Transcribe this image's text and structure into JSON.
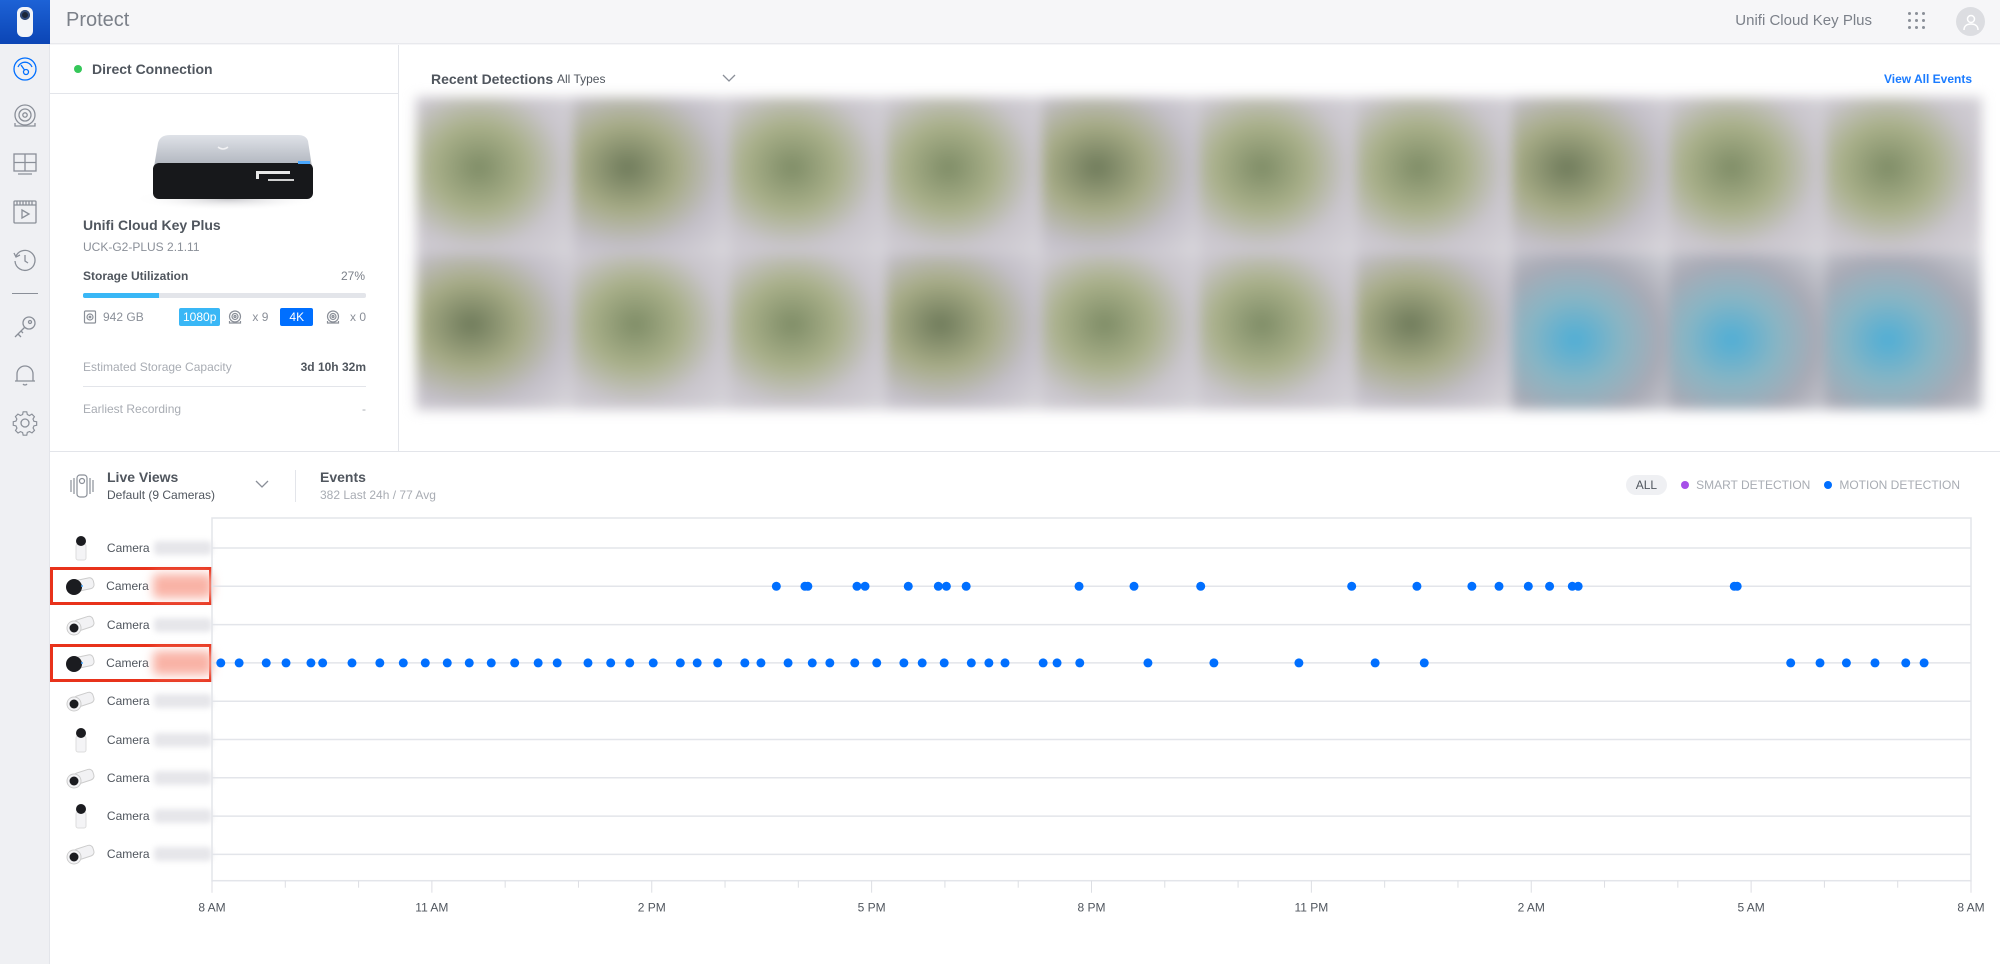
{
  "header": {
    "app_title": "Protect",
    "controller_name": "Unifi Cloud Key Plus",
    "apps_icon": "grid-dots-icon",
    "avatar_icon": "user-icon"
  },
  "sidebar": {
    "logo": "protect-camera-logo",
    "items": [
      {
        "name": "dashboard",
        "icon": "dashboard-icon",
        "active": true
      },
      {
        "name": "devices",
        "icon": "camera-icon",
        "active": false
      },
      {
        "name": "liveview",
        "icon": "grid-icon",
        "active": false
      },
      {
        "name": "timelapse",
        "icon": "video-icon",
        "active": false
      },
      {
        "name": "events",
        "icon": "history-icon",
        "active": false
      },
      {
        "name": "access",
        "icon": "key-icon",
        "active": false
      },
      {
        "name": "notifications",
        "icon": "bell-icon",
        "active": false
      },
      {
        "name": "settings",
        "icon": "gear-icon",
        "active": false
      }
    ]
  },
  "status": {
    "connection_label": "Direct Connection",
    "connection_color": "#35c759"
  },
  "device": {
    "name": "Unifi Cloud Key Plus",
    "model": "UCK-G2-PLUS 2.1.11",
    "storage_label": "Storage Utilization",
    "storage_percent_text": "27%",
    "storage_percent": 27,
    "disk_size": "942 GB",
    "res_1080_label": "1080p",
    "res_1080_count": "x 9",
    "res_4k_label": "4K",
    "res_4k_count": "x 0",
    "est_capacity_label": "Estimated Storage Capacity",
    "est_capacity_value": "3d 10h 32m",
    "earliest_label": "Earliest Recording",
    "earliest_value": "-"
  },
  "recent_detections": {
    "title": "Recent Detections",
    "filter": "All Types",
    "view_all": "View All Events",
    "thumbnail_count": 20
  },
  "live_views": {
    "title": "Live Views",
    "subtitle": "Default (9 Cameras)"
  },
  "events": {
    "title": "Events",
    "subtitle": "382 Last 24h / 77 Avg",
    "legend": {
      "all": "ALL",
      "smart": "SMART DETECTION",
      "motion": "MOTION DETECTION",
      "smart_color": "#a64fe8",
      "motion_color": "#006fff"
    }
  },
  "chart_data": {
    "type": "scatter",
    "title": "Events",
    "xlabel": "",
    "ylabel": "",
    "x_unit": "hours since 8 AM",
    "xlim": [
      0,
      24
    ],
    "x_ticks": [
      "8 AM",
      "11 AM",
      "2 PM",
      "5 PM",
      "8 PM",
      "11 PM",
      "2 AM",
      "5 AM",
      "8 AM"
    ],
    "x_tick_values": [
      0,
      3,
      6,
      9,
      12,
      15,
      18,
      21,
      24
    ],
    "minor_tick_step_hours": 1,
    "grid": true,
    "legend_position": "top-right",
    "categories": [
      {
        "label": "Camera",
        "type": "dome",
        "flagged": false
      },
      {
        "label": "Camera",
        "type": "bullet-dark",
        "flagged": true
      },
      {
        "label": "Camera",
        "type": "bullet",
        "flagged": false
      },
      {
        "label": "Camera",
        "type": "bullet-dark",
        "flagged": true
      },
      {
        "label": "Camera",
        "type": "bullet",
        "flagged": false
      },
      {
        "label": "Camera",
        "type": "dome",
        "flagged": false
      },
      {
        "label": "Camera",
        "type": "bullet",
        "flagged": false
      },
      {
        "label": "Camera",
        "type": "dome",
        "flagged": false
      },
      {
        "label": "Camera",
        "type": "bullet",
        "flagged": false
      }
    ],
    "series": [
      {
        "name": "MOTION DETECTION",
        "color": "#006fff",
        "points": [
          {
            "row": 1,
            "x": [
              7.7,
              8.09,
              8.13,
              8.8,
              8.91,
              9.5,
              9.91,
              10.02,
              10.29,
              11.83,
              12.58,
              13.49,
              15.55,
              16.44,
              17.19,
              17.56,
              17.96,
              18.25,
              18.56,
              18.64,
              20.77,
              20.81
            ]
          },
          {
            "row": 3,
            "x": [
              0.12,
              0.37,
              0.74,
              1.01,
              1.35,
              1.51,
              1.91,
              2.29,
              2.61,
              2.91,
              3.21,
              3.51,
              3.81,
              4.13,
              4.45,
              4.71,
              5.13,
              5.44,
              5.7,
              6.02,
              6.39,
              6.62,
              6.9,
              7.27,
              7.49,
              7.86,
              8.19,
              8.43,
              8.77,
              9.07,
              9.44,
              9.69,
              9.99,
              10.36,
              10.6,
              10.82,
              11.34,
              11.53,
              11.84,
              12.77,
              13.67,
              14.83,
              15.87,
              16.54,
              21.54,
              21.94,
              22.3,
              22.69,
              23.11,
              23.36
            ]
          }
        ]
      },
      {
        "name": "SMART DETECTION",
        "color": "#a64fe8",
        "points": []
      }
    ]
  }
}
